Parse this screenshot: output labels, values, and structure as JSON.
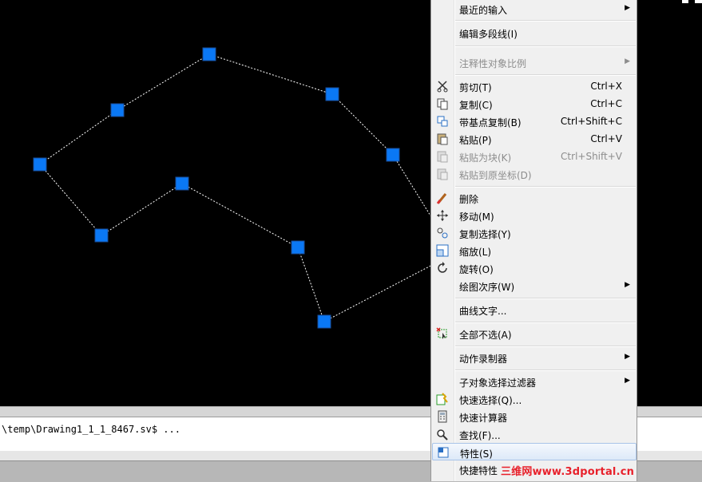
{
  "command_line": {
    "history_text": "\\temp\\Drawing1_1_1_8467.sv$ ..."
  },
  "context_menu": {
    "items": [
      {
        "label": "最近的输入",
        "shortcut": "",
        "submenu": true,
        "disabled": false,
        "icon": ""
      },
      {
        "label": "编辑多段线(I)",
        "shortcut": "",
        "submenu": false,
        "disabled": false,
        "icon": ""
      },
      {
        "label": "注释性对象比例",
        "shortcut": "",
        "submenu": true,
        "disabled": true,
        "icon": ""
      },
      {
        "label": "剪切(T)",
        "shortcut": "Ctrl+X",
        "submenu": false,
        "disabled": false,
        "icon": "scissors-icon"
      },
      {
        "label": "复制(C)",
        "shortcut": "Ctrl+C",
        "submenu": false,
        "disabled": false,
        "icon": "copy-icon"
      },
      {
        "label": "带基点复制(B)",
        "shortcut": "Ctrl+Shift+C",
        "submenu": false,
        "disabled": false,
        "icon": "copy-base-icon"
      },
      {
        "label": "粘贴(P)",
        "shortcut": "Ctrl+V",
        "submenu": false,
        "disabled": false,
        "icon": "paste-icon"
      },
      {
        "label": "粘贴为块(K)",
        "shortcut": "Ctrl+Shift+V",
        "submenu": false,
        "disabled": true,
        "icon": "paste-block-icon"
      },
      {
        "label": "粘贴到原坐标(D)",
        "shortcut": "",
        "submenu": false,
        "disabled": true,
        "icon": "paste-original-icon"
      },
      {
        "label": "删除",
        "shortcut": "",
        "submenu": false,
        "disabled": false,
        "icon": "eraser-icon"
      },
      {
        "label": "移动(M)",
        "shortcut": "",
        "submenu": false,
        "disabled": false,
        "icon": "move-icon"
      },
      {
        "label": "复制选择(Y)",
        "shortcut": "",
        "submenu": false,
        "disabled": false,
        "icon": "copy-selection-icon"
      },
      {
        "label": "缩放(L)",
        "shortcut": "",
        "submenu": false,
        "disabled": false,
        "icon": "scale-icon"
      },
      {
        "label": "旋转(O)",
        "shortcut": "",
        "submenu": false,
        "disabled": false,
        "icon": "rotate-icon"
      },
      {
        "label": "绘图次序(W)",
        "shortcut": "",
        "submenu": true,
        "disabled": false,
        "icon": ""
      },
      {
        "label": "曲线文字...",
        "shortcut": "",
        "submenu": false,
        "disabled": false,
        "icon": ""
      },
      {
        "label": "全部不选(A)",
        "shortcut": "",
        "submenu": false,
        "disabled": false,
        "icon": "deselect-icon"
      },
      {
        "label": "动作录制器",
        "shortcut": "",
        "submenu": true,
        "disabled": false,
        "icon": ""
      },
      {
        "label": "子对象选择过滤器",
        "shortcut": "",
        "submenu": true,
        "disabled": false,
        "icon": ""
      },
      {
        "label": "快速选择(Q)...",
        "shortcut": "",
        "submenu": false,
        "disabled": false,
        "icon": "quick-select-icon"
      },
      {
        "label": "快速计算器",
        "shortcut": "",
        "submenu": false,
        "disabled": false,
        "icon": "calculator-icon"
      },
      {
        "label": "查找(F)...",
        "shortcut": "",
        "submenu": false,
        "disabled": false,
        "icon": "find-icon"
      },
      {
        "label": "特性(S)",
        "shortcut": "",
        "submenu": false,
        "disabled": false,
        "icon": "properties-icon"
      },
      {
        "label": "快捷特性",
        "shortcut": "",
        "submenu": false,
        "disabled": false,
        "icon": ""
      }
    ]
  },
  "watermark": "三维网www.3dportal.cn",
  "colors": {
    "grip": "#0a78f5",
    "polyline": "#ffffff",
    "menu_bg": "#f0f0f0",
    "watermark": "#e8202a"
  }
}
